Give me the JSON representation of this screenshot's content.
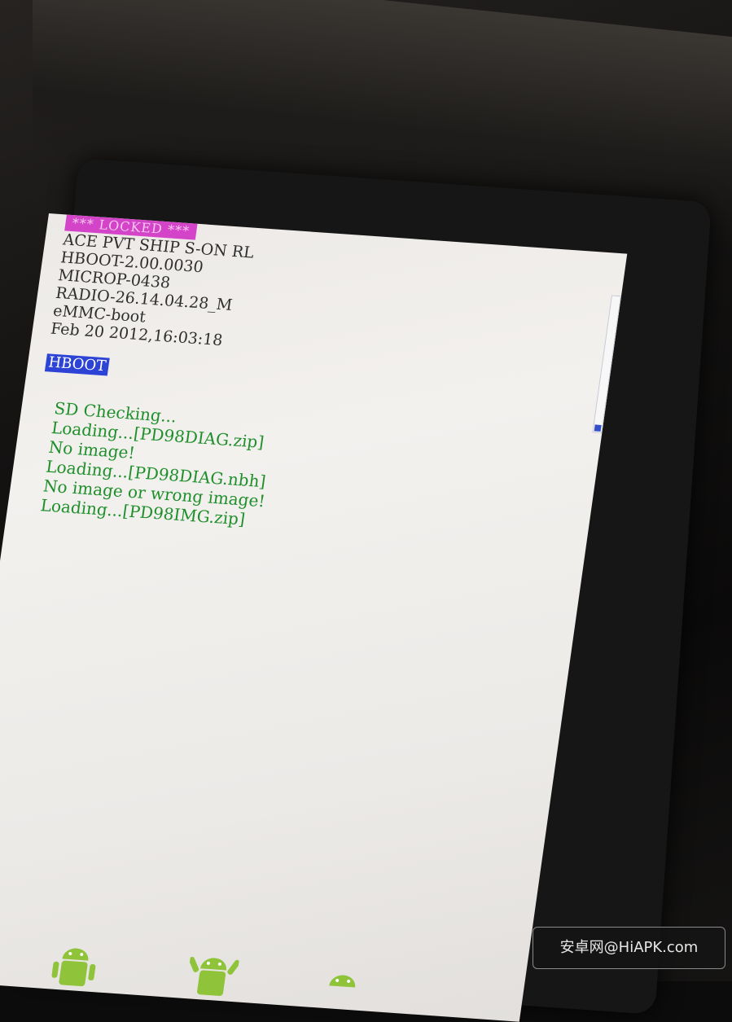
{
  "bootloader": {
    "lock_status": "*** LOCKED ***",
    "info_lines": [
      "ACE PVT SHIP S-ON RL",
      "HBOOT-2.00.0030",
      "MICROP-0438",
      "RADIO-26.14.04.28_M",
      "eMMC-boot",
      "Feb 20 2012,16:03:18"
    ],
    "mode_label": "HBOOT",
    "log_lines": [
      "SD Checking...",
      "Loading...[PD98DIAG.zip]",
      "No image!",
      "Loading...[PD98DIAG.nbh]",
      "No image or wrong image!",
      "Loading...[PD98IMG.zip]"
    ]
  },
  "watermark": {
    "text": "安卓网@HiAPK.com"
  },
  "colors": {
    "locked_badge": "#d444c9",
    "mode_highlight": "#2c43d6",
    "log_text": "#1f8f2b",
    "info_text": "#2f2f2f",
    "screen_bg": "#efece9"
  },
  "icons": [
    "android-robot-icon",
    "android-robot-icon",
    "android-robot-icon"
  ]
}
